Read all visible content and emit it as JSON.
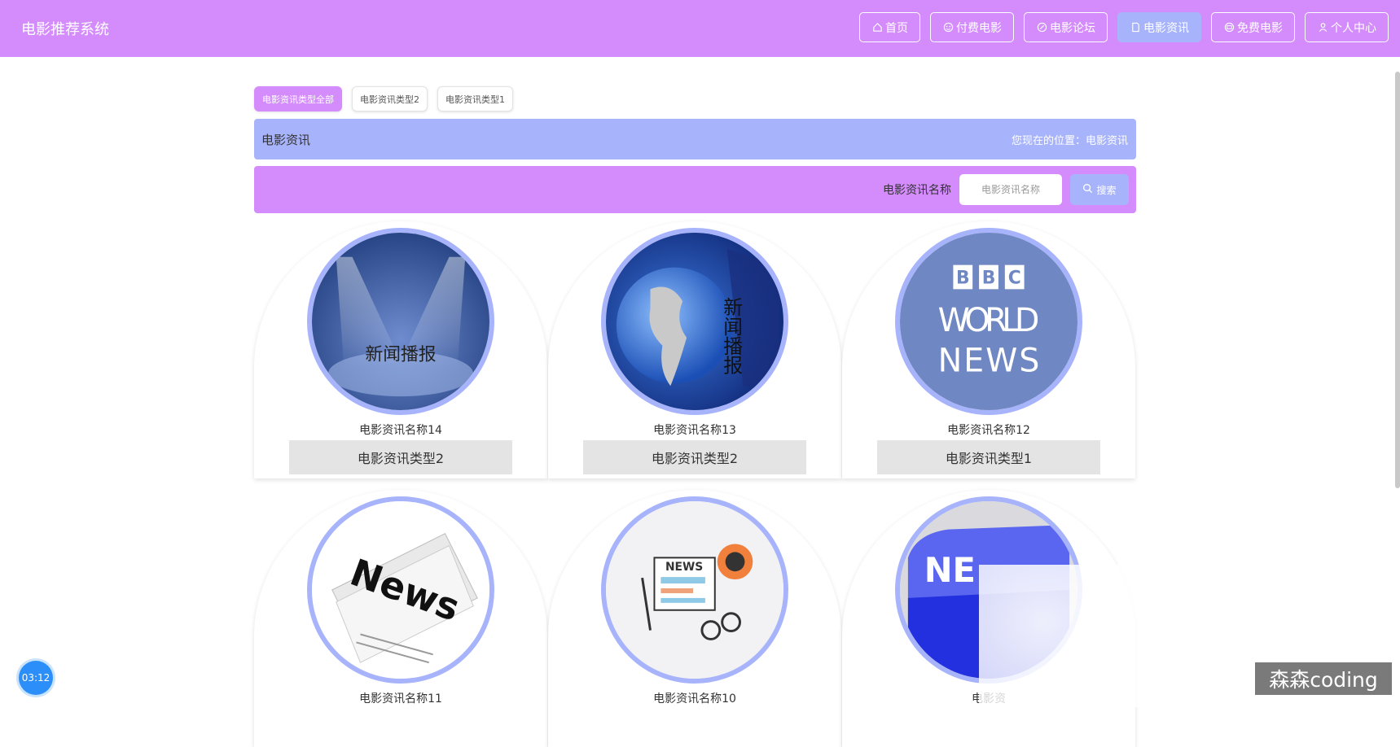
{
  "header": {
    "brand": "电影推荐系统",
    "nav": [
      {
        "label": "首页",
        "icon": "home-icon",
        "active": false
      },
      {
        "label": "付费电影",
        "icon": "film-icon",
        "active": false
      },
      {
        "label": "电影论坛",
        "icon": "edit-icon",
        "active": false
      },
      {
        "label": "电影资讯",
        "icon": "document-icon",
        "active": true
      },
      {
        "label": "免费电影",
        "icon": "ticket-icon",
        "active": false
      },
      {
        "label": "个人中心",
        "icon": "user-icon",
        "active": false
      }
    ]
  },
  "tabs": [
    {
      "label": "电影资讯类型全部",
      "active": true
    },
    {
      "label": "电影资讯类型2",
      "active": false
    },
    {
      "label": "电影资讯类型1",
      "active": false
    }
  ],
  "location": {
    "title": "电影资讯",
    "path": "您现在的位置：电影资讯"
  },
  "search": {
    "label": "电影资讯名称",
    "placeholder": "电影资讯名称",
    "button": "搜索"
  },
  "cards": [
    {
      "name": "电影资讯名称14",
      "type": "电影资讯类型2",
      "image": "spotlight-stage",
      "caption": "新闻播报"
    },
    {
      "name": "电影资讯名称13",
      "type": "电影资讯类型2",
      "image": "globe-news",
      "caption": "新闻播报"
    },
    {
      "name": "电影资讯名称12",
      "type": "电影资讯类型1",
      "image": "bbc-world-news",
      "caption": "BBC WORLD NEWS"
    },
    {
      "name": "电影资讯名称11",
      "type": "",
      "image": "newspaper",
      "caption": "News"
    },
    {
      "name": "电影资讯名称10",
      "type": "",
      "image": "news-illustration",
      "caption": "NEWS"
    },
    {
      "name": "电影资",
      "type": "",
      "image": "news-keyboard",
      "caption": "NE"
    }
  ],
  "overlay": {
    "timer": "03:12",
    "watermark": "森森coding"
  },
  "colors": {
    "primary": "#d48cfd",
    "secondary": "#a7b4fb",
    "card_type_bg": "#e4e4e4"
  }
}
